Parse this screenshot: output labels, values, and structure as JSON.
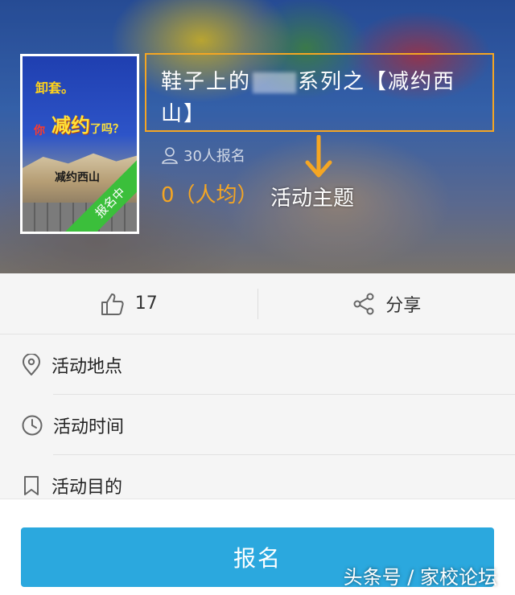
{
  "header": {
    "cover": {
      "line1": "卸套。",
      "line2": "你",
      "line3": "减约",
      "line4": "了吗？",
      "line5": "减约西山",
      "ribbon": "报名中"
    },
    "title_part1": "鞋子上的",
    "title_part2": "系列之【减约西山】",
    "signup_count": "30人报名",
    "price": "0（人均）",
    "annotation": "活动主题"
  },
  "actions": {
    "like_count": "17",
    "share_label": "分享"
  },
  "info": [
    {
      "label": "活动地点",
      "icon": "location-pin-icon"
    },
    {
      "label": "活动时间",
      "icon": "clock-icon"
    },
    {
      "label": "活动目的",
      "icon": "bookmark-icon"
    }
  ],
  "signup_button_label": "报名",
  "watermark": "头条号 / 家校论坛",
  "colors": {
    "accent_orange": "#f5a623",
    "button_blue": "#2ba8de",
    "ribbon_green": "#3bbf3b"
  }
}
